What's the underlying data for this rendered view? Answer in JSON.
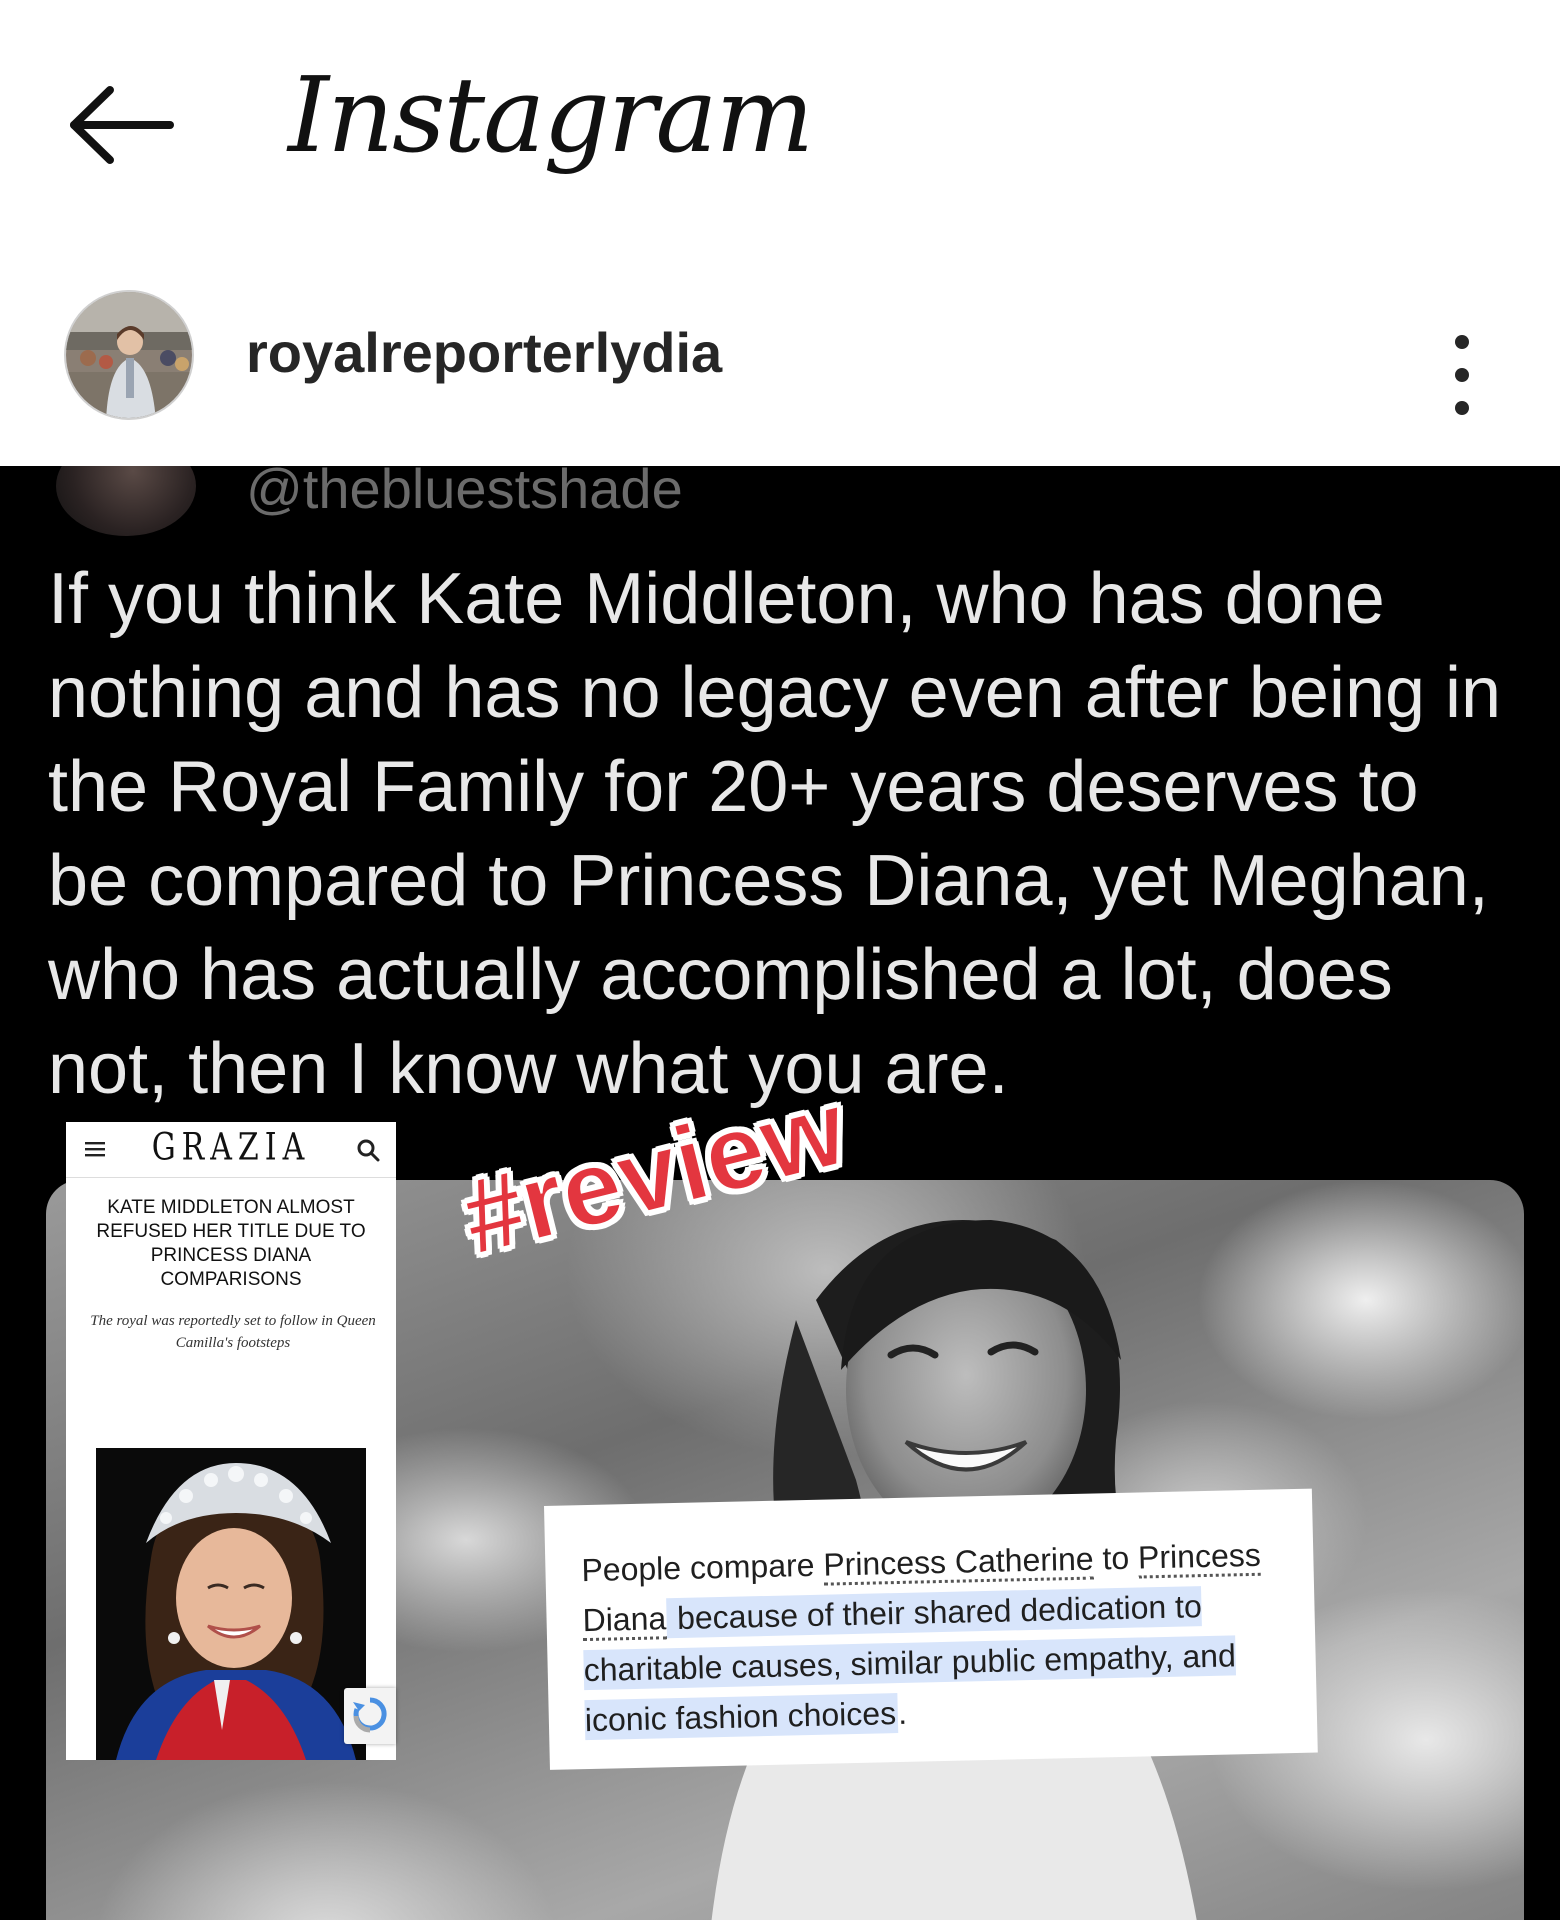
{
  "header": {
    "app_name": "Instagram",
    "back_icon": "arrow-left-icon"
  },
  "post": {
    "username": "royalreporterlydia",
    "more_icon": "vertical-ellipsis-icon"
  },
  "tweet": {
    "handle": "@thebluestshade",
    "text": "If you think Kate Middleton, who has  done nothing and has no legacy even after being in the Royal Family for 20+ years deserves to be compared to Princess Diana, yet Meghan, who has actually accomplished a lot, does not, then I know what you are."
  },
  "grazia": {
    "brand": "GRAZIA",
    "headline": "KATE MIDDLETON ALMOST REFUSED HER TITLE DUE TO PRINCESS DIANA COMPARISONS",
    "subheadline": "The royal was reportedly set to follow in Queen Camilla's footsteps",
    "menu_icon": "hamburger-menu-icon",
    "search_icon": "search-icon"
  },
  "sticker": {
    "text": "#review",
    "color": "#e3363f"
  },
  "answer": {
    "intro": "People compare ",
    "link1": "Princess Catherine",
    "mid": " to ",
    "link2": "Princess Diana",
    "highlight": " because of their shared dedication to charitable causes, similar public empathy, and iconic fashion choices",
    "end": "."
  },
  "colors": {
    "highlight": "#d8e5fb",
    "post_background": "#000000",
    "tweet_text": "#e8e8e8"
  }
}
